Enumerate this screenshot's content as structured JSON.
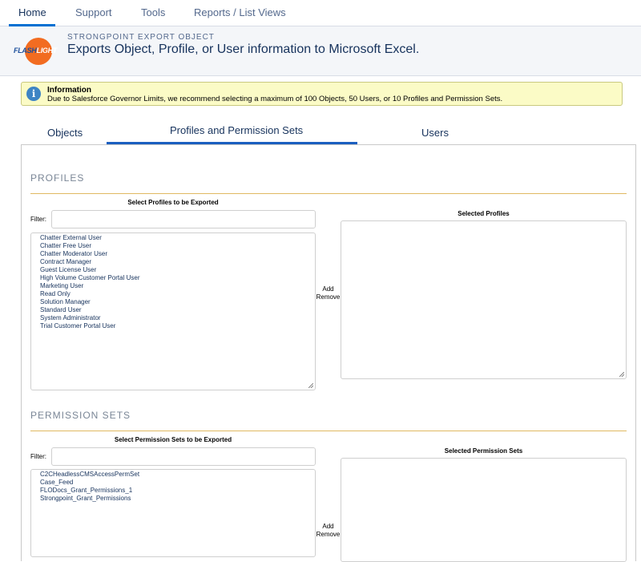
{
  "nav": {
    "items": [
      "Home",
      "Support",
      "Tools",
      "Reports / List Views"
    ]
  },
  "header": {
    "logo_text_a": "FLASH",
    "logo_text_b": "LIGHT",
    "eyebrow": "STRONGPOINT EXPORT OBJECT",
    "title": "Exports Object, Profile, or User information to Microsoft Excel."
  },
  "info": {
    "icon": "i",
    "title": "Information",
    "text": "Due to Salesforce Governor Limits, we recommend selecting a maximum of 100 Objects, 50 Users, or 10 Profiles and Permission Sets."
  },
  "tabs": {
    "objects": "Objects",
    "profiles": "Profiles and Permission Sets",
    "users": "Users"
  },
  "profiles": {
    "section_title": "PROFILES",
    "available_label": "Select Profiles to be Exported",
    "filter_label": "Filter:",
    "selected_label": "Selected Profiles",
    "add_label": "Add",
    "remove_label": "Remove",
    "options": [
      "Chatter External User",
      "Chatter Free User",
      "Chatter Moderator User",
      "Contract Manager",
      "Guest License User",
      "High Volume Customer Portal User",
      "Marketing User",
      "Read Only",
      "Solution Manager",
      "Standard User",
      "System Administrator",
      "Trial Customer Portal User"
    ]
  },
  "permsets": {
    "section_title": "PERMISSION SETS",
    "available_label": "Select Permission Sets to be Exported",
    "filter_label": "Filter:",
    "selected_label": "Selected Permission Sets",
    "add_label": "Add",
    "remove_label": "Remove",
    "options": [
      "C2CHeadlessCMSAccessPermSet",
      "Case_Feed",
      "FLODocs_Grant_Permissions_1",
      "Strongpoint_Grant_Permissions"
    ]
  }
}
